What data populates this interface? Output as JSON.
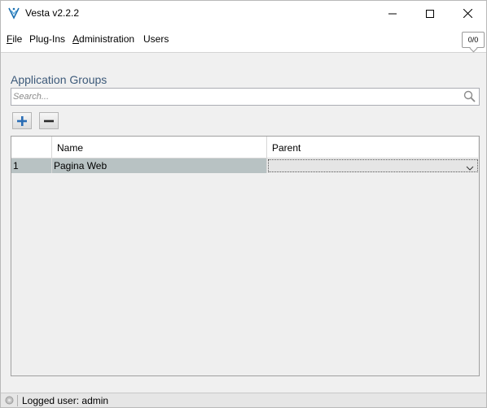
{
  "window": {
    "title": "Vesta v2.2.2",
    "icon": "vesta-logo-icon",
    "buttons": [
      "minimize-icon",
      "maximize-icon",
      "close-icon"
    ]
  },
  "menu": {
    "items": [
      {
        "label": "File",
        "mnemonic": "F",
        "rest": "ile"
      },
      {
        "label": "Plug-Ins"
      },
      {
        "label": "Administration",
        "mnemonic": "A",
        "rest": "dministration"
      },
      {
        "label": "Users"
      }
    ],
    "counter": "0/0"
  },
  "section": {
    "title": "Application Groups"
  },
  "search": {
    "placeholder": "Search...",
    "value": "",
    "icon": "search-icon"
  },
  "toolbar": {
    "add_icon": "plus-icon",
    "remove_icon": "minus-icon"
  },
  "table": {
    "columns": [
      "",
      "Name",
      "Parent"
    ],
    "rows": [
      {
        "index": "1",
        "name": "Pagina Web",
        "parent": ""
      }
    ]
  },
  "status": {
    "text": "Logged user: admin",
    "icon": "status-gear-icon"
  },
  "colors": {
    "section_title": "#3d5a7a",
    "row_selected": "#b8c2c3",
    "plus_icon": "#2a6db5"
  }
}
